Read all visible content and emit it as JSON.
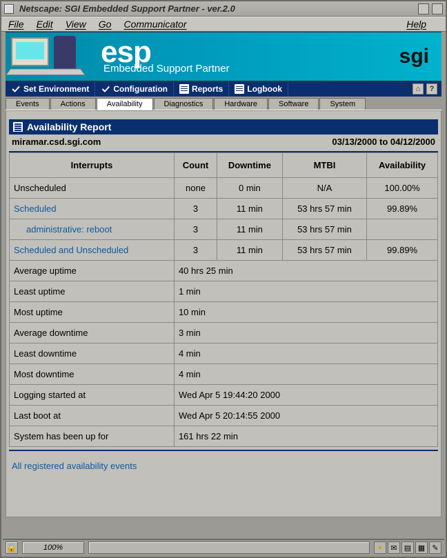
{
  "window": {
    "title": "Netscape: SGI Embedded Support Partner - ver.2.0"
  },
  "menu": {
    "file": "File",
    "edit": "Edit",
    "view": "View",
    "go": "Go",
    "communicator": "Communicator",
    "help": "Help"
  },
  "banner": {
    "logo": "esp",
    "subtitle": "Embedded Support Partner",
    "brand": "sgi"
  },
  "topnav": {
    "set_env": "Set Environment",
    "configuration": "Configuration",
    "reports": "Reports",
    "logbook": "Logbook",
    "home": "⌂",
    "help": "?"
  },
  "subtabs": {
    "events": "Events",
    "actions": "Actions",
    "availability": "Availability",
    "diagnostics": "Diagnostics",
    "hardware": "Hardware",
    "software": "Software",
    "system": "System"
  },
  "report": {
    "title": "Availability Report",
    "host": "miramar.csd.sgi.com",
    "period": "03/13/2000 to 04/12/2000",
    "columns": {
      "interrupts": "Interrupts",
      "count": "Count",
      "downtime": "Downtime",
      "mtbi": "MTBI",
      "availability": "Availability"
    },
    "rows": [
      {
        "label": "Unscheduled",
        "count": "none",
        "downtime": "0 min",
        "mtbi": "N/A",
        "avail": "100.00%",
        "link": false
      },
      {
        "label": "Scheduled",
        "count": "3",
        "downtime": "11 min",
        "mtbi": "53 hrs 57 min",
        "avail": "99.89%",
        "link": true
      },
      {
        "label": "administrative: reboot",
        "count": "3",
        "downtime": "11 min",
        "mtbi": "53 hrs 57 min",
        "avail": "",
        "link": true,
        "indent": true
      },
      {
        "label": "Scheduled and Unscheduled",
        "count": "3",
        "downtime": "11 min",
        "mtbi": "53 hrs 57 min",
        "avail": "99.89%",
        "link": true
      }
    ],
    "summary": [
      {
        "label": "Average uptime",
        "value": "40 hrs 25 min"
      },
      {
        "label": "Least uptime",
        "value": "1 min"
      },
      {
        "label": "Most uptime",
        "value": "10 min"
      },
      {
        "label": "Average downtime",
        "value": "3 min"
      },
      {
        "label": "Least downtime",
        "value": "4 min"
      },
      {
        "label": "Most downtime",
        "value": "4 min"
      },
      {
        "label": "Logging started at",
        "value": "Wed Apr 5 19:44:20 2000"
      },
      {
        "label": "Last boot at",
        "value": "Wed Apr 5 20:14:55 2000"
      },
      {
        "label": "System has been up for",
        "value": "161 hrs 22 min"
      }
    ],
    "footlink": "All registered availability events"
  },
  "status": {
    "percent": "100%"
  }
}
